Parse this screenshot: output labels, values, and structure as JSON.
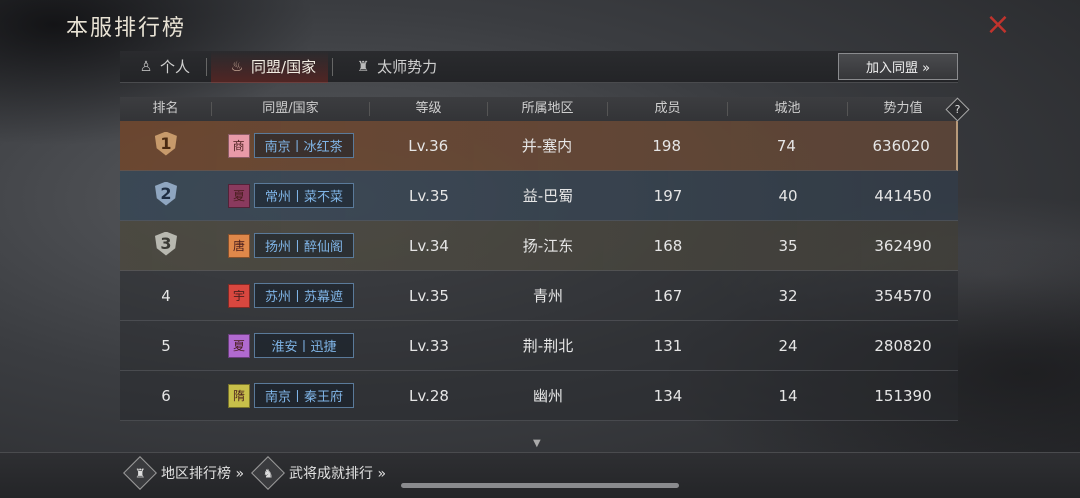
{
  "header": {
    "title": "本服排行榜"
  },
  "close_icon": "×",
  "tabs": [
    {
      "label": "个人",
      "icon": "♙"
    },
    {
      "label": "同盟/国家",
      "icon": "♨"
    },
    {
      "label": "太师势力",
      "icon": "♜"
    }
  ],
  "join_button": "加入同盟 »",
  "help_icon": "?",
  "columns": [
    "排名",
    "同盟/国家",
    "等级",
    "所属地区",
    "成员",
    "城池",
    "势力值"
  ],
  "rows": [
    {
      "rank": "1",
      "emblem": "商",
      "emblem_color": "#e89aa8",
      "alliance": "南京丨冰红茶",
      "level": "Lv.36",
      "region": "并-塞内",
      "members": "198",
      "cities": "74",
      "power": "636020"
    },
    {
      "rank": "2",
      "emblem": "夏",
      "emblem_color": "#8a3a5e",
      "alliance": "常州丨菜不菜",
      "level": "Lv.35",
      "region": "益-巴蜀",
      "members": "197",
      "cities": "40",
      "power": "441450"
    },
    {
      "rank": "3",
      "emblem": "唐",
      "emblem_color": "#e0884a",
      "alliance": "扬州丨醉仙阁",
      "level": "Lv.34",
      "region": "扬-江东",
      "members": "168",
      "cities": "35",
      "power": "362490"
    },
    {
      "rank": "4",
      "emblem": "宇",
      "emblem_color": "#d8473f",
      "alliance": "苏州丨苏幕遮",
      "level": "Lv.35",
      "region": "青州",
      "members": "167",
      "cities": "32",
      "power": "354570"
    },
    {
      "rank": "5",
      "emblem": "夏",
      "emblem_color": "#b16ad0",
      "alliance": "淮安丨迅捷",
      "level": "Lv.33",
      "region": "荆-荆北",
      "members": "131",
      "cities": "24",
      "power": "280820"
    },
    {
      "rank": "6",
      "emblem": "隋",
      "emblem_color": "#c8c04a",
      "alliance": "南京丨秦王府",
      "level": "Lv.28",
      "region": "幽州",
      "members": "134",
      "cities": "14",
      "power": "151390"
    }
  ],
  "bottom_nav": [
    {
      "label": "地区排行榜 »",
      "icon": "♜"
    },
    {
      "label": "武将成就排行 »",
      "icon": "♞"
    }
  ]
}
